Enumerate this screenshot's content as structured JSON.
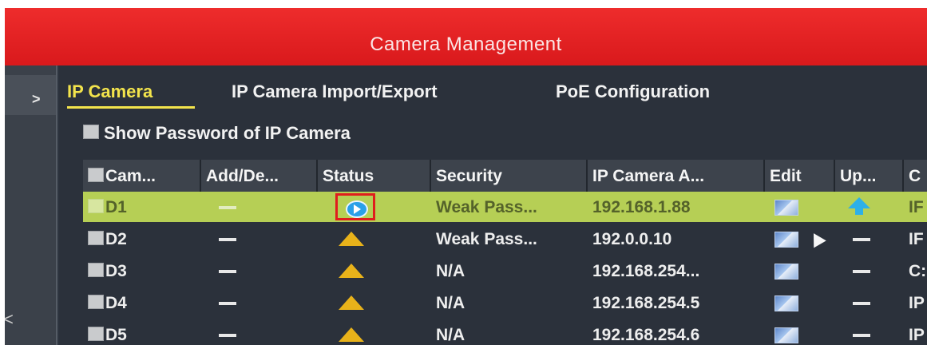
{
  "window": {
    "title": "Camera Management"
  },
  "tabs": [
    {
      "label": "IP Camera",
      "active": true
    },
    {
      "label": "IP Camera Import/Export",
      "active": false
    },
    {
      "label": "PoE Configuration",
      "active": false
    }
  ],
  "show_password": {
    "label": "Show Password of IP Camera",
    "checked": false
  },
  "table": {
    "columns": [
      "Cam...",
      "Add/De...",
      "Status",
      "Security",
      "IP Camera A...",
      "Edit",
      "Up...",
      "C"
    ],
    "rows": [
      {
        "camera": "D1",
        "add_delete": "—",
        "status": "play-icon",
        "security": "Weak Pass...",
        "ip": "192.168.1.88",
        "edit": "edit-icon",
        "upgrade": "upgrade-icon",
        "extra": "IF",
        "selected": true
      },
      {
        "camera": "D2",
        "add_delete": "—",
        "status": "warning-icon",
        "security": "Weak Pass...",
        "ip": "192.0.0.10",
        "edit": "edit-icon",
        "upgrade": "—",
        "extra": "IF",
        "selected": false
      },
      {
        "camera": "D3",
        "add_delete": "—",
        "status": "warning-icon",
        "security": "N/A",
        "ip": "192.168.254...",
        "edit": "edit-icon",
        "upgrade": "—",
        "extra": "C:",
        "selected": false
      },
      {
        "camera": "D4",
        "add_delete": "—",
        "status": "warning-icon",
        "security": "N/A",
        "ip": "192.168.254.5",
        "edit": "edit-icon",
        "upgrade": "—",
        "extra": "IP",
        "selected": false
      },
      {
        "camera": "D5",
        "add_delete": "—",
        "status": "warning-icon",
        "security": "N/A",
        "ip": "192.168.254.6",
        "edit": "edit-icon",
        "upgrade": "—",
        "extra": "IP",
        "selected": false
      }
    ]
  },
  "colors": {
    "title_bar": "#e02326",
    "active_tab": "#f3e44c",
    "selected_row": "#b6cf55",
    "highlight_box": "#e01d1d"
  }
}
